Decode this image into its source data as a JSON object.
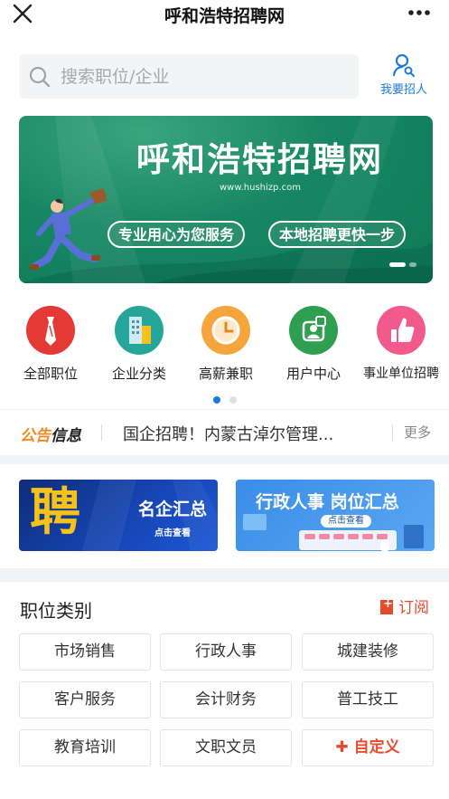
{
  "app": {
    "title": "呼和浩特招聘网",
    "recruit_label": "我要招人"
  },
  "search": {
    "placeholder": "搜索职位/企业"
  },
  "banner": {
    "title": "呼和浩特招聘网",
    "url": "www.hushizp.com",
    "slogan_left": "专业用心为您服务",
    "slogan_right": "本地招聘更快一步",
    "slide_index": 1,
    "slide_count": 2
  },
  "categories": [
    {
      "label": "全部职位",
      "icon": "tie-icon",
      "color": "#e53935"
    },
    {
      "label": "企业分类",
      "icon": "building-icon",
      "color": "#26a69a"
    },
    {
      "label": "高薪兼职",
      "icon": "clock-icon",
      "color": "#f5a53b"
    },
    {
      "label": "用户中心",
      "icon": "user-center-icon",
      "color": "#2e9e4f"
    },
    {
      "label": "事业单位招聘",
      "icon": "thumbs-up-icon",
      "color": "#f15a8a"
    }
  ],
  "category_pager": {
    "current": 1,
    "count": 2
  },
  "notice": {
    "logo_part1": "公告",
    "logo_part2": "信息",
    "text": "国企招聘！内蒙古淖尔管理...",
    "more": "更多"
  },
  "promos": [
    {
      "big": "聘",
      "title": "名企汇总",
      "sub": "点击查看"
    },
    {
      "title": "行政人事  岗位汇总",
      "sub": "点击查看"
    }
  ],
  "jobs": {
    "heading": "职位类别",
    "subscribe": "订阅",
    "tags": [
      "市场销售",
      "行政人事",
      "城建装修",
      "客户服务",
      "会计财务",
      "普工技工",
      "教育培训",
      "文职文员"
    ],
    "custom": "✚ 自定义"
  },
  "colors": {
    "accent_blue": "#1e7ad8",
    "accent_red": "#e54b2c",
    "banner_green": "#178763"
  }
}
